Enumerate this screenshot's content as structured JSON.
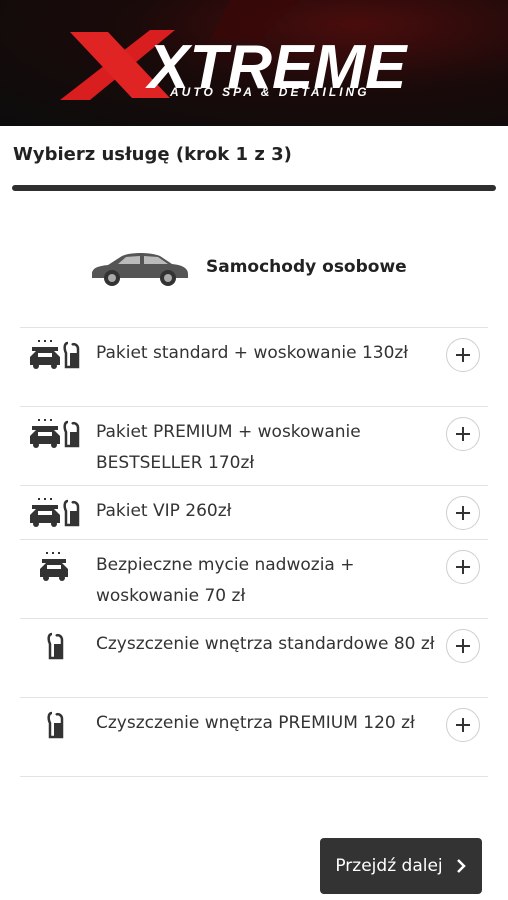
{
  "header": {
    "logo_text": "XTREME",
    "logo_subtext": "AUTO SPA & DETAILING"
  },
  "step": {
    "title": "Wybierz usługę (krok 1 z 3)",
    "progress_fraction": 0.333
  },
  "category": {
    "label": "Samochody osobowe",
    "icon": "car-icon"
  },
  "services": [
    {
      "label": "Pakiet standard + woskowanie 130zł",
      "icons": [
        "car-wash-icon",
        "vacuum-icon"
      ]
    },
    {
      "label": "Pakiet PREMIUM + woskowanie BESTSELLER 170zł",
      "icons": [
        "car-wash-icon",
        "vacuum-icon"
      ]
    },
    {
      "label": "Pakiet VIP 260zł",
      "icons": [
        "car-wash-icon",
        "vacuum-icon"
      ]
    },
    {
      "label": "Bezpieczne mycie nadwozia + woskowanie 70 zł",
      "icons": [
        "car-wash-icon"
      ]
    },
    {
      "label": "Czyszczenie wnętrza standardowe 80 zł",
      "icons": [
        "vacuum-icon"
      ]
    },
    {
      "label": "Czyszczenie wnętrza PREMIUM 120 zł",
      "icons": [
        "vacuum-icon"
      ]
    }
  ],
  "next_button": {
    "label": "Przejdź dalej"
  },
  "colors": {
    "brand_red": "#d81e1e",
    "dark": "#333333"
  }
}
